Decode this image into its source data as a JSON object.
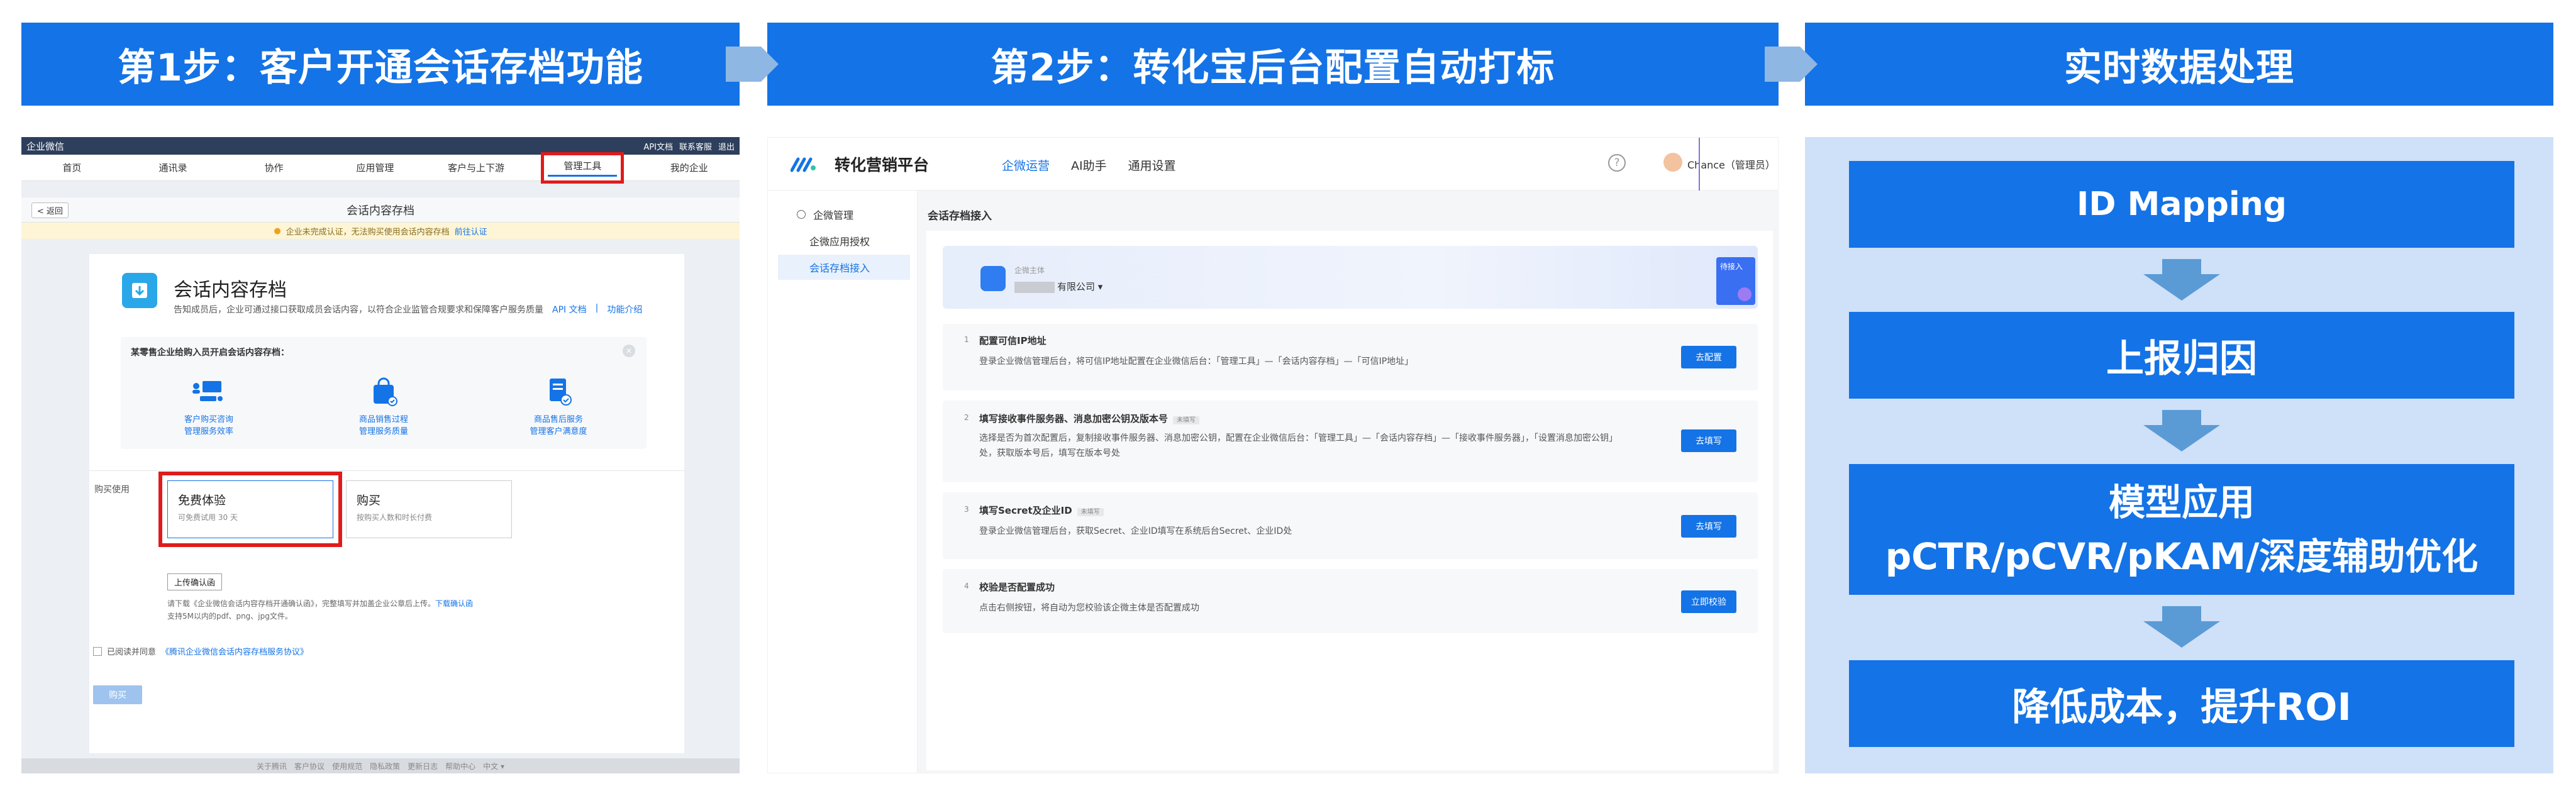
{
  "headers": {
    "step1": "第1步：客户开通会话存档功能",
    "step2": "第2步：转化宝后台配置自动打标",
    "step3": "实时数据处理"
  },
  "panel1": {
    "topbar": {
      "logo": "企业微信",
      "links": [
        "API文档",
        "联系客服",
        "退出"
      ]
    },
    "nav": [
      "首页",
      "通讯录",
      "协作",
      "应用管理",
      "客户与上下游",
      "管理工具",
      "我的企业"
    ],
    "highlighted_nav": "管理工具",
    "back": "< 返回",
    "page_title": "会话内容存档",
    "warning": {
      "text": "企业未完成认证，无法购买使用会话内容存档",
      "link": "前往认证"
    },
    "app": {
      "title": "会话内容存档",
      "desc": "告知成员后，企业可通过接口获取成员会话内容，以符合企业监管合规要求和保障客户服务质量",
      "links": [
        "API 文档",
        "|",
        "功能介绍"
      ]
    },
    "features": {
      "title": "某零售企业给购入员开启会话内容存档：",
      "items": [
        {
          "line1": "客户购买咨询",
          "line2": "管理服务效率",
          "icon": "people-icon"
        },
        {
          "line1": "商品销售过程",
          "line2": "管理服务质量",
          "icon": "bag-icon"
        },
        {
          "line1": "商品售后服务",
          "line2": "管理客户满意度",
          "icon": "document-icon"
        }
      ]
    },
    "purchase_label": "购买使用",
    "options": [
      {
        "title": "免费体验",
        "desc": "可免费试用 30 天"
      },
      {
        "title": "购买",
        "desc": "按购买人数和时长付费"
      }
    ],
    "upload_button": "上传确认函",
    "upload_note_1": "请下载《企业微信会话内容存档开通确认函》，完整填写并加盖企业公章后上传。",
    "upload_note_link": "下载确认函",
    "upload_note_2": "支持5M以内的pdf、png、jpg文件。",
    "agree_text": "已阅读并同意",
    "agree_link": "《腾讯企业微信会话内容存档服务协议》",
    "buy_button": "购买",
    "footer": [
      "关于腾讯",
      "客户协议",
      "使用规范",
      "隐私政策",
      "更新日志",
      "帮助中心",
      "中文 ▾"
    ]
  },
  "panel2": {
    "brand": "转化营销平台",
    "tabs": [
      "企微运营",
      "AI助手",
      "通用设置"
    ],
    "active_tab": "企微运营",
    "help": "?",
    "user": "Chance（管理员）",
    "sidebar": [
      {
        "label": "企微管理",
        "active": false
      },
      {
        "label": "企微应用授权",
        "active": false
      },
      {
        "label": "会话存档接入",
        "active": true
      }
    ],
    "page_title": "会话存档接入",
    "banner": {
      "label": "企微主体",
      "value_suffix": "有限公司 ▾",
      "badge": "待接入"
    },
    "steps": [
      {
        "num": "1",
        "title": "配置可信IP地址",
        "tag": "",
        "desc": "登录企业微信管理后台，将可信IP地址配置在企业微信后台：「管理工具」—「会话内容存档」—「可信IP地址」",
        "button": "去配置"
      },
      {
        "num": "2",
        "title": "填写接收事件服务器、消息加密公钥及版本号",
        "tag": "未填写",
        "desc": "选择是否为首次配置后，复制接收事件服务器、消息加密公钥，配置在企业微信后台：「管理工具」—「会话内容存档」—「接收事件服务器」，「设置消息加密公钥」处，获取版本号后，填写在版本号处",
        "button": "去填写"
      },
      {
        "num": "3",
        "title": "填写Secret及企业ID",
        "tag": "未填写",
        "desc": "登录企业微信管理后台，获取Secret、企业ID填写在系统后台Secret、企业ID处",
        "button": "去填写"
      },
      {
        "num": "4",
        "title": "校验是否配置成功",
        "tag": "",
        "desc": "点击右侧按钮，将自动为您校验该企微主体是否配置成功",
        "button": "立即校验"
      }
    ]
  },
  "panel3": {
    "boxes": [
      {
        "line1": "ID Mapping",
        "line2": ""
      },
      {
        "line1": "上报归因",
        "line2": ""
      },
      {
        "line1": "模型应用",
        "line2": "pCTR/pCVR/pKAM/深度辅助优化"
      },
      {
        "line1": "降低成本，提升ROI",
        "line2": ""
      }
    ]
  },
  "colors": {
    "header_blue": "#1473E6",
    "arrow_blue": "#5b9bd5",
    "highlight_red": "#e01b1b",
    "panel3_bg": "#cfe0f9"
  }
}
